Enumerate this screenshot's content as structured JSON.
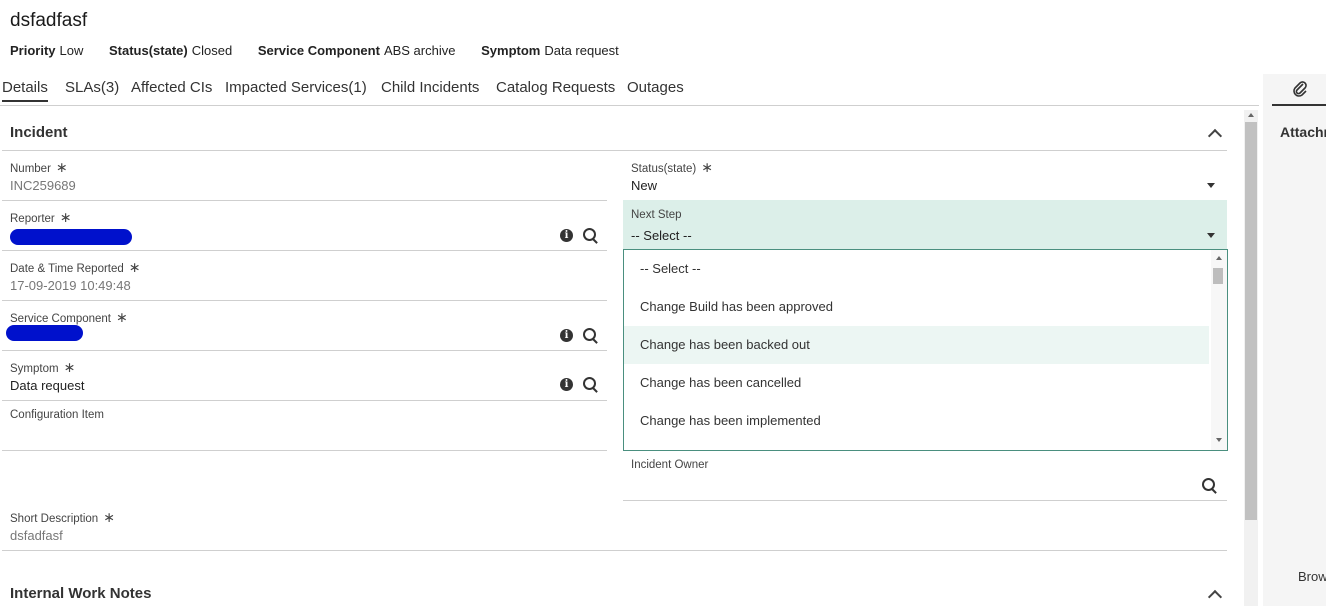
{
  "header": {
    "title": "dsfadfasf",
    "meta": [
      {
        "key": "Priority",
        "value": "Low"
      },
      {
        "key": "Status(state)",
        "value": "Closed"
      },
      {
        "key": "Service Component",
        "value": "ABS archive"
      },
      {
        "key": "Symptom",
        "value": "Data request"
      }
    ]
  },
  "tabs": [
    "Details",
    "SLAs(3)",
    "Affected CIs",
    "Impacted Services(1)",
    "Child Incidents",
    "Catalog Requests",
    "Outages"
  ],
  "incident": {
    "section_title": "Incident",
    "required_mark": "∗",
    "number_label": "Number",
    "number_value": "INC259689",
    "reporter_label": "Reporter",
    "date_label": "Date & Time Reported",
    "date_value": "17-09-2019 10:49:48",
    "service_component_label": "Service Component",
    "symptom_label": "Symptom",
    "symptom_value": "Data request",
    "config_item_label": "Configuration Item",
    "status_label": "Status(state)",
    "status_value": "New",
    "next_step_label": "Next Step",
    "next_step_value": "-- Select --",
    "next_step_options": [
      "-- Select --",
      "Change Build has been approved",
      "Change has been backed out",
      "Change has been cancelled",
      "Change has been implemented"
    ],
    "incident_owner_label": "Incident Owner",
    "short_desc_label": "Short Description",
    "short_desc_value": "dsfadfasf"
  },
  "work_notes": {
    "section_title": "Internal Work Notes"
  },
  "right_panel": {
    "attach_label": "Attachn",
    "browse_label": "Brow"
  },
  "icons": {
    "info": "i"
  }
}
